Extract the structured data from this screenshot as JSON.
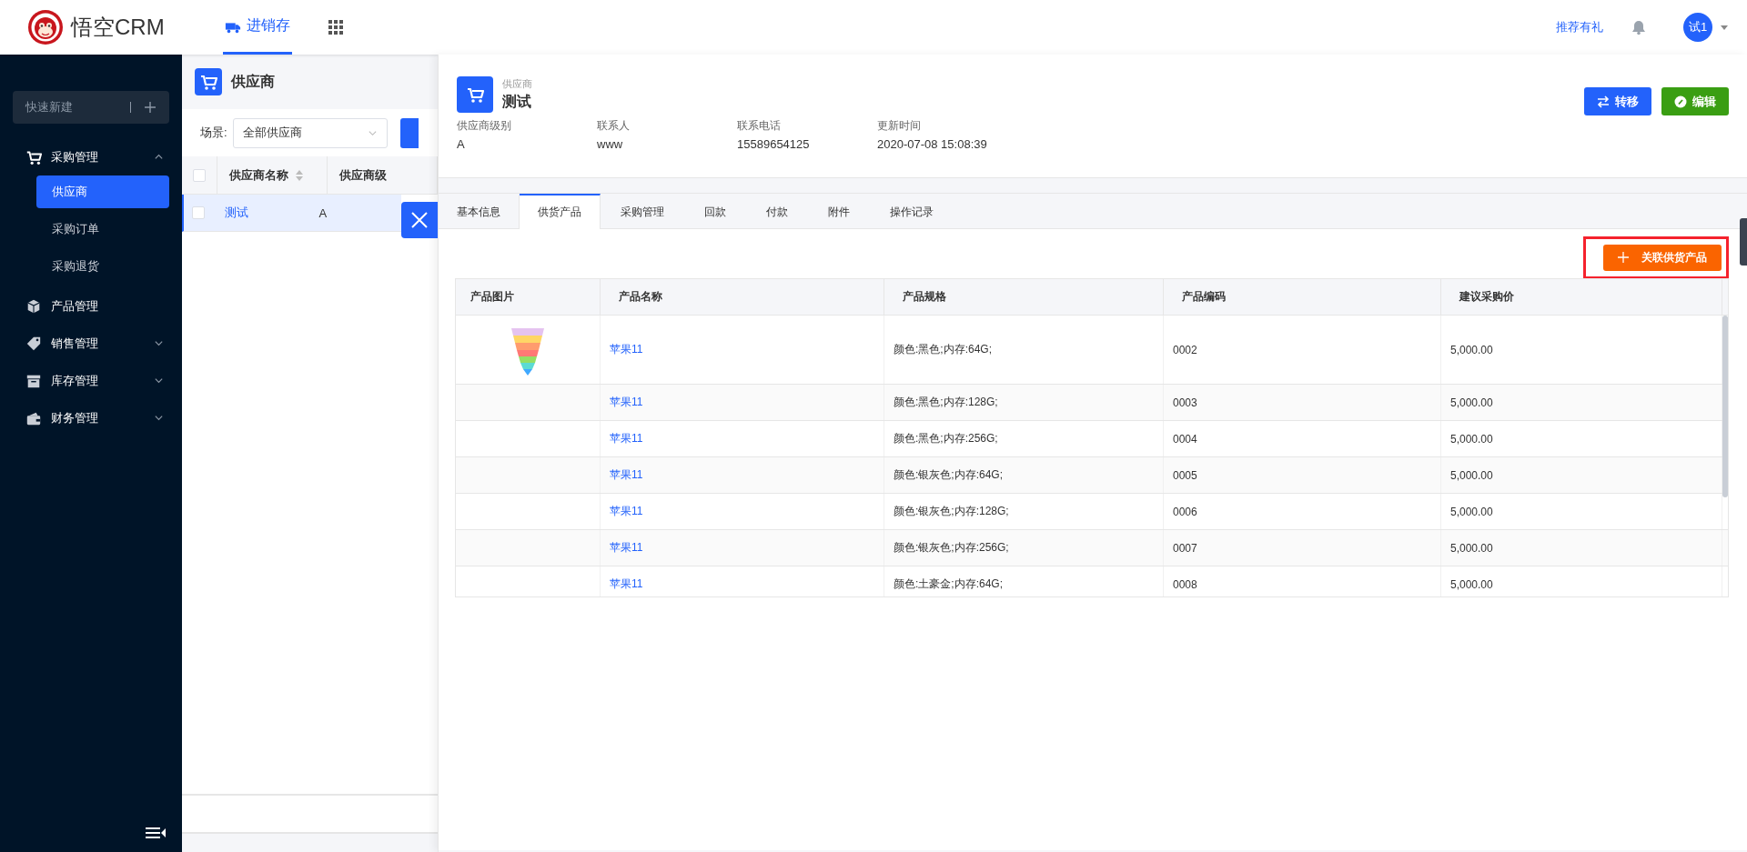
{
  "header": {
    "brand": "悟空CRM",
    "nav": [
      {
        "label": "进销存",
        "selected": true
      }
    ],
    "recommend_link": "推荐有礼",
    "avatar": "试1"
  },
  "sidebar": {
    "quick_create": "快速新建",
    "menu": [
      {
        "label": "采购管理",
        "expanded": true,
        "children": [
          {
            "label": "供应商",
            "selected": true
          },
          {
            "label": "采购订单",
            "selected": false
          },
          {
            "label": "采购退货",
            "selected": false
          }
        ]
      },
      {
        "label": "产品管理"
      },
      {
        "label": "销售管理",
        "expanded": false
      },
      {
        "label": "库存管理",
        "expanded": false
      },
      {
        "label": "财务管理",
        "expanded": false
      }
    ]
  },
  "list": {
    "title": "供应商",
    "scene_label": "场景:",
    "scene_value": "全部供应商",
    "all_checked": false,
    "columns": [
      "供应商名称",
      "供应商级"
    ],
    "rows": [
      {
        "cells": [
          "测试",
          "A"
        ],
        "selected": true,
        "checked": false
      }
    ]
  },
  "detail": {
    "type_label": "供应商",
    "name": "测试",
    "fields": [
      {
        "label": "供应商级别",
        "value": "A"
      },
      {
        "label": "联系人",
        "value": "www"
      },
      {
        "label": "联系电话",
        "value": "15589654125"
      },
      {
        "label": "更新时间",
        "value": "2020-07-08 15:08:39"
      }
    ],
    "actions": [
      {
        "label": "转移",
        "kind": "transfer"
      },
      {
        "label": "编辑",
        "kind": "edit"
      }
    ],
    "tabs": [
      {
        "label": "基本信息",
        "selected": false
      },
      {
        "label": "供货产品",
        "selected": true
      },
      {
        "label": "采购管理",
        "selected": false
      },
      {
        "label": "回款",
        "selected": false
      },
      {
        "label": "付款",
        "selected": false
      },
      {
        "label": "附件",
        "selected": false
      },
      {
        "label": "操作记录",
        "selected": false
      }
    ],
    "add_button": "关联供货产品",
    "table": {
      "columns": [
        "产品图片",
        "产品名称",
        "产品规格",
        "产品编码",
        "建议采购价"
      ],
      "rows": [
        {
          "picture": true,
          "name": "苹果11",
          "spec": "颜色:黑色;内存:64G;",
          "code": "0002",
          "price": "5,000.00"
        },
        {
          "picture": false,
          "name": "苹果11",
          "spec": "颜色:黑色;内存:128G;",
          "code": "0003",
          "price": "5,000.00"
        },
        {
          "picture": false,
          "name": "苹果11",
          "spec": "颜色:黑色;内存:256G;",
          "code": "0004",
          "price": "5,000.00"
        },
        {
          "picture": false,
          "name": "苹果11",
          "spec": "颜色:银灰色;内存:64G;",
          "code": "0005",
          "price": "5,000.00"
        },
        {
          "picture": false,
          "name": "苹果11",
          "spec": "颜色:银灰色;内存:128G;",
          "code": "0006",
          "price": "5,000.00"
        },
        {
          "picture": false,
          "name": "苹果11",
          "spec": "颜色:银灰色;内存:256G;",
          "code": "0007",
          "price": "5,000.00"
        },
        {
          "picture": false,
          "name": "苹果11",
          "spec": "颜色:土豪金;内存:64G;",
          "code": "0008",
          "price": "5,000.00"
        }
      ]
    }
  }
}
